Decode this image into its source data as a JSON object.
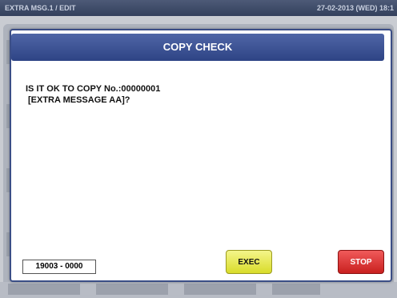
{
  "topbar": {
    "title": "EXTRA MSG.1 / EDIT",
    "date": "27-02-2013 (WED) 18:1"
  },
  "dialog": {
    "title": "COPY CHECK",
    "message_line1": "IS IT OK TO COPY No.:00000001",
    "message_line2": "[EXTRA MESSAGE AA]?",
    "code": "19003 - 0000",
    "exec_label": "EXEC",
    "stop_label": "STOP"
  },
  "colors": {
    "header": "#2e4485",
    "exec_button": "#e5e84a",
    "stop_button": "#d92b2b"
  }
}
